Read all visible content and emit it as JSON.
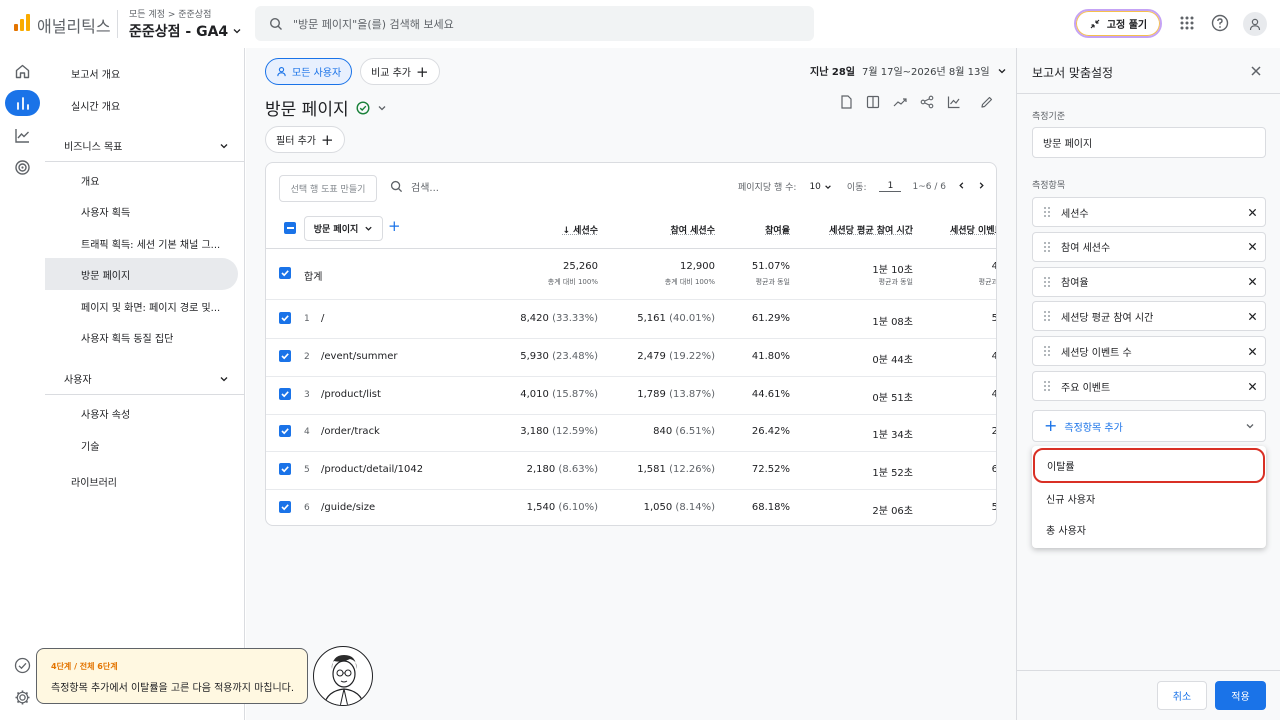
{
  "header": {
    "brand": "애널리틱스",
    "account_crumb": "모든 계정 > 준준상점",
    "property": "준준상점 - GA4",
    "search_placeholder": "\"방문 페이지\"을(를) 검색해 보세요",
    "pin_label": "고정 풀기"
  },
  "rail": {
    "items": [
      "home-icon",
      "reports-icon",
      "explore-icon",
      "advertising-icon"
    ],
    "bottom": [
      "admin-check-icon",
      "settings-icon"
    ]
  },
  "sidenav": {
    "items": [
      {
        "label": "보고서 개요"
      },
      {
        "label": "실시간 개요"
      }
    ],
    "section_business": "비즈니스 목표",
    "business_items": [
      {
        "label": "개요"
      },
      {
        "label": "사용자 획득"
      },
      {
        "label": "트래픽 획득: 세션 기본 채널 그..."
      },
      {
        "label": "방문 페이지"
      },
      {
        "label": "페이지 및 화면: 페이지 경로 및..."
      },
      {
        "label": "사용자 획득 동질 집단"
      }
    ],
    "section_user": "사용자",
    "user_items": [
      {
        "label": "사용자 속성"
      },
      {
        "label": "기술"
      }
    ],
    "library": "라이브러리"
  },
  "main": {
    "chip_all_users": "모든 사용자",
    "chip_compare": "비교 추가",
    "date_label": "지난 28일",
    "date_range": "7월 17일~2026년 8월 13일",
    "title": "방문 페이지",
    "filter_chip": "필터 추가",
    "table": {
      "make_chart": "선택 행 도표 만들기",
      "search_placeholder": "검색...",
      "rows_per_page_label": "페이지당 행 수:",
      "rows_per_page": "10",
      "goto_label": "이동:",
      "goto_value": "1",
      "range": "1~6 / 6",
      "dimension": "방문 페이지",
      "headers": [
        "↓ 세션수",
        "참여 세션수",
        "참여율",
        "세션당 평균 참여 시간",
        "세션당 이벤트"
      ],
      "total": {
        "label": "합계",
        "values": [
          "25,260",
          "12,900",
          "51.07%",
          "1분 10초",
          "4"
        ],
        "subs": [
          "총계 대비 100%",
          "총계 대비 100%",
          "평균과 동일",
          "평균과 동일",
          "평균과"
        ]
      },
      "rows": [
        {
          "n": "1",
          "page": "/",
          "sessions": "8,420",
          "sessions_pct": "(33.33%)",
          "engaged": "5,161",
          "engaged_pct": "(40.01%)",
          "rate": "61.29%",
          "time": "1분 08초",
          "events": "5"
        },
        {
          "n": "2",
          "page": "/event/summer",
          "sessions": "5,930",
          "sessions_pct": "(23.48%)",
          "engaged": "2,479",
          "engaged_pct": "(19.22%)",
          "rate": "41.80%",
          "time": "0분 44초",
          "events": "4"
        },
        {
          "n": "3",
          "page": "/product/list",
          "sessions": "4,010",
          "sessions_pct": "(15.87%)",
          "engaged": "1,789",
          "engaged_pct": "(13.87%)",
          "rate": "44.61%",
          "time": "0분 51초",
          "events": "4"
        },
        {
          "n": "4",
          "page": "/order/track",
          "sessions": "3,180",
          "sessions_pct": "(12.59%)",
          "engaged": "840",
          "engaged_pct": "(6.51%)",
          "rate": "26.42%",
          "time": "1분 34초",
          "events": "2"
        },
        {
          "n": "5",
          "page": "/product/detail/1042",
          "sessions": "2,180",
          "sessions_pct": "(8.63%)",
          "engaged": "1,581",
          "engaged_pct": "(12.26%)",
          "rate": "72.52%",
          "time": "1분 52초",
          "events": "6"
        },
        {
          "n": "6",
          "page": "/guide/size",
          "sessions": "1,540",
          "sessions_pct": "(6.10%)",
          "engaged": "1,050",
          "engaged_pct": "(8.14%)",
          "rate": "68.18%",
          "time": "2분 06초",
          "events": "5"
        }
      ]
    }
  },
  "panel": {
    "title": "보고서 맞춤설정",
    "dimension_label": "측정기준",
    "dimension_value": "방문 페이지",
    "metrics_label": "측정항목",
    "metrics": [
      "세션수",
      "참여 세션수",
      "참여율",
      "세션당 평균 참여 시간",
      "세션당 이벤트 수",
      "주요 이벤트"
    ],
    "add_metric": "측정항목 추가",
    "dropdown": [
      "이탈률",
      "신규 사용자",
      "총 사용자"
    ],
    "cancel": "취소",
    "apply": "적용"
  },
  "guide": {
    "step": "4단계 / 전체 6단계",
    "text": "측정항목 추가에서 이탈률을 고른 다음 적용까지 마칩니다."
  },
  "colors": {
    "accent": "#1a73e8",
    "highlight": "#d93025",
    "logo": "#f9ab00"
  }
}
